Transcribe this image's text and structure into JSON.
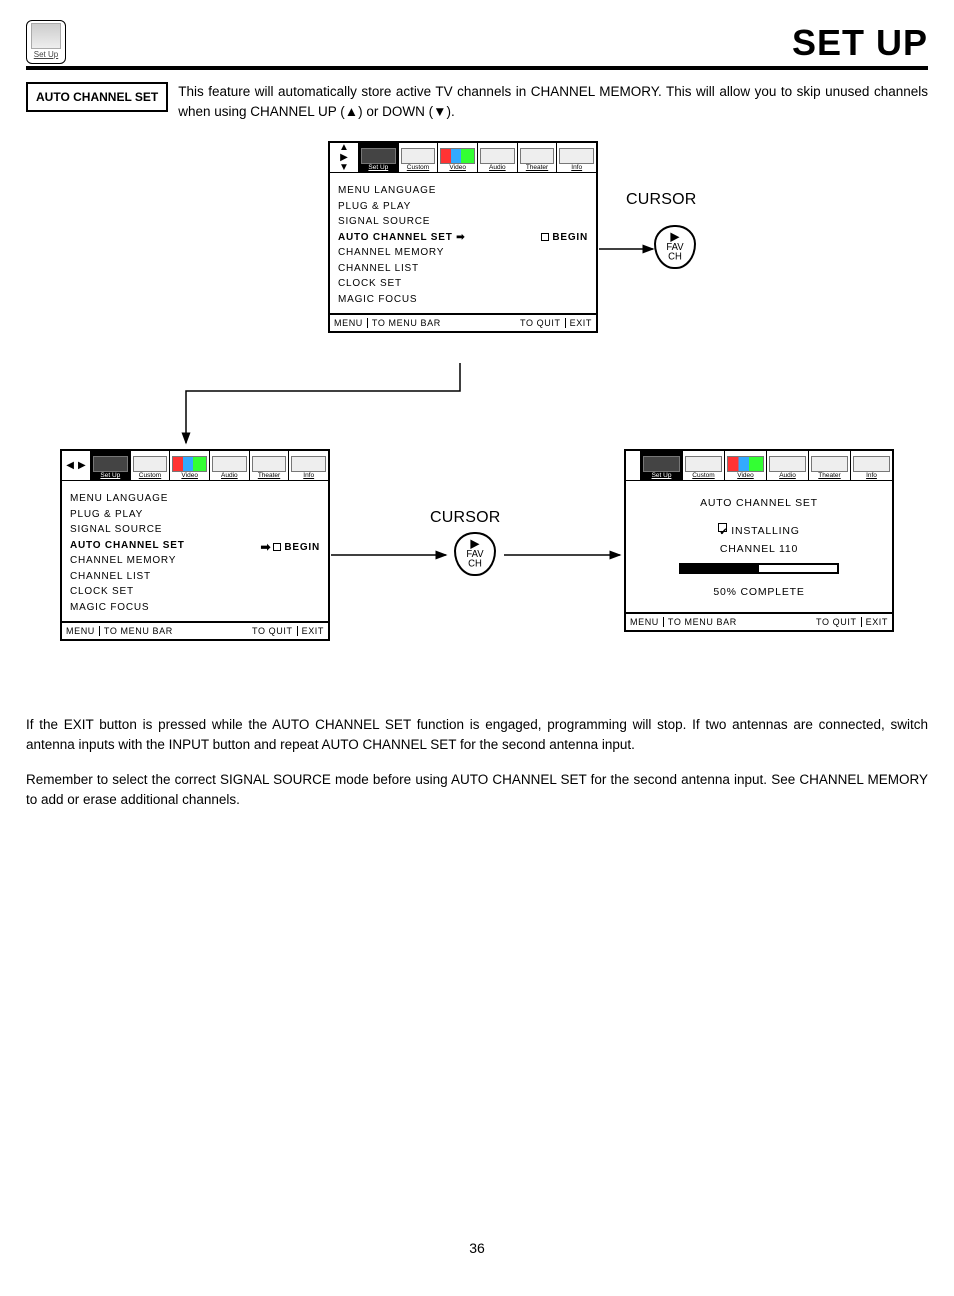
{
  "pageTitle": "SET UP",
  "iconLabel": "Set Up",
  "tag": "AUTO CHANNEL SET",
  "introText": "This feature will automatically store active TV channels in CHANNEL MEMORY.  This will allow you to skip unused channels when using CHANNEL UP (▲) or DOWN (▼).",
  "menuBar": {
    "items": [
      "Set Up",
      "Custom",
      "Video",
      "Audio",
      "Theater",
      "Info"
    ]
  },
  "menuList": {
    "items": [
      "MENU LANGUAGE",
      "PLUG & PLAY",
      "SIGNAL SOURCE",
      "AUTO CHANNEL SET",
      "CHANNEL MEMORY",
      "CHANNEL LIST",
      "CLOCK SET",
      "MAGIC FOCUS"
    ],
    "selectedIndex": 3,
    "beginLabel": "BEGIN"
  },
  "footer": {
    "menu": "MENU",
    "toMenuBar": "TO MENU BAR",
    "toQuit": "TO QUIT",
    "exit": "EXIT"
  },
  "cursorLabel": "CURSOR",
  "favch": {
    "tri": "▶",
    "l1": "FAV",
    "l2": "CH"
  },
  "progress": {
    "title": "AUTO CHANNEL SET",
    "installing": "INSTALLING",
    "channel": "CHANNEL 110",
    "percent": 50,
    "complete": "50% COMPLETE"
  },
  "para1": "If the EXIT button is pressed while the AUTO CHANNEL SET function is engaged, programming will stop.  If two antennas are connected, switch antenna inputs with the INPUT button and repeat AUTO CHANNEL SET for the second antenna input.",
  "para2": "Remember to select the correct SIGNAL SOURCE mode before using AUTO CHANNEL SET for the second antenna input.  See CHANNEL MEMORY to add or erase additional channels.",
  "pageNumber": "36"
}
